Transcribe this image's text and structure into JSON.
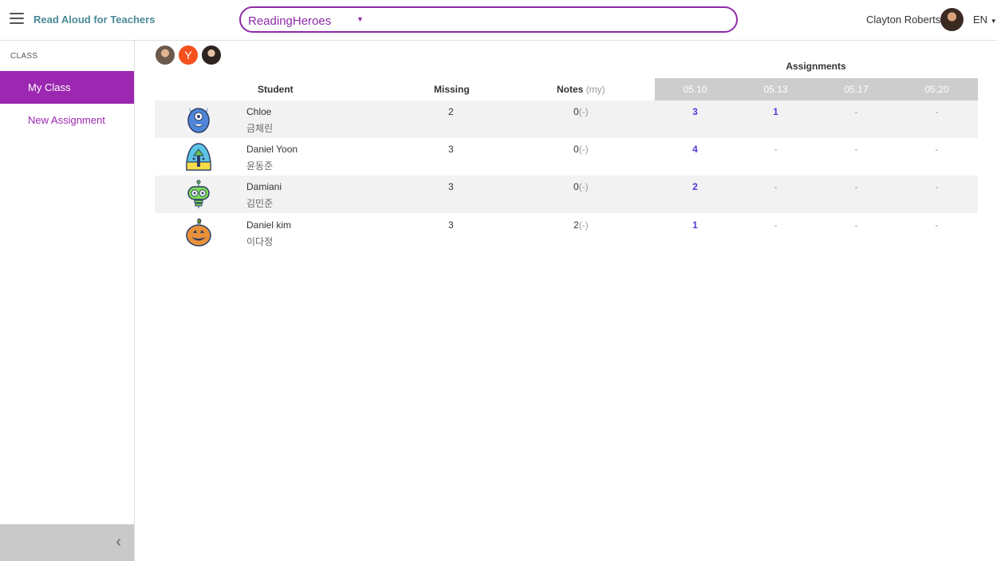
{
  "header": {
    "app_title": "Read Aloud for Teachers",
    "class_selected": "ReadingHeroes",
    "user_name": "Clayton Roberts",
    "language": "EN"
  },
  "sidebar": {
    "section_label": "CLASS",
    "items": [
      {
        "label": "My Class",
        "active": true
      },
      {
        "label": "New Assignment",
        "active": false
      }
    ],
    "collapse_icon": "chevron-left-icon"
  },
  "teachers": [
    {
      "type": "photo"
    },
    {
      "type": "initial",
      "initial": "Y",
      "color": "#f4511e"
    },
    {
      "type": "photo"
    }
  ],
  "table": {
    "assignments_title": "Assignments",
    "headers": {
      "student": "Student",
      "missing": "Missing",
      "notes": "Notes",
      "notes_suffix": "(my)"
    },
    "dates": [
      "05.10",
      "05.13",
      "05.17",
      "05.20"
    ],
    "rows": [
      {
        "name": "Chloe",
        "korean": "금체린",
        "avatar": "blue-monster-icon",
        "missing": "2",
        "notes": "0",
        "notes_my": "(-)",
        "scores": [
          "3",
          "1",
          "-",
          "-"
        ]
      },
      {
        "name": "Daniel Yoon",
        "korean": "윤동준",
        "avatar": "egg-alien-icon",
        "missing": "3",
        "notes": "0",
        "notes_my": "(-)",
        "scores": [
          "4",
          "-",
          "-",
          "-"
        ]
      },
      {
        "name": "Damiani",
        "korean": "김민준",
        "avatar": "green-robot-icon",
        "missing": "3",
        "notes": "0",
        "notes_my": "(-)",
        "scores": [
          "2",
          "-",
          "-",
          "-"
        ]
      },
      {
        "name": "Daniel kim",
        "korean": "이다정",
        "avatar": "pumpkin-icon",
        "missing": "3",
        "notes": "2",
        "notes_my": "(-)",
        "scores": [
          "1",
          "-",
          "-",
          "-"
        ]
      }
    ]
  },
  "colors": {
    "accent": "#9c27b0",
    "select_border": "#8e2aa8",
    "title_teal": "#4a8a96",
    "score_link": "#4d3bd6",
    "header_bar": "#cdcdcd"
  }
}
